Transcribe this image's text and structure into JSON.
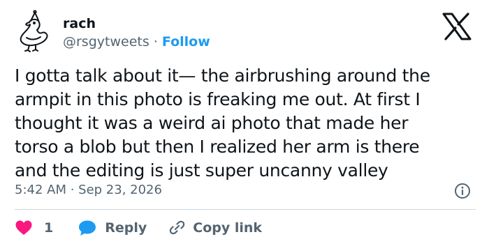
{
  "author": {
    "name": "rach",
    "handle": "@rsgytweets",
    "separator": "·",
    "follow_label": "Follow",
    "avatar_icon": "duck-doodle-avatar"
  },
  "brand": {
    "logo_icon": "x-logo-icon"
  },
  "tweet": {
    "text": "I gotta talk about it— the airbrushing around the\narmpit in this photo is freaking me out. At first I\nthought it was a weird ai photo that made her\ntorso a blob but then I realized her arm is there\nand the editing is just super uncanny valley",
    "timestamp": "5:42 AM · Sep 23, 2026",
    "info_icon": "info-icon"
  },
  "actions": {
    "like_count": "1",
    "reply_label": "Reply",
    "copy_label": "Copy link"
  },
  "colors": {
    "text": "#0f1419",
    "secondary": "#536471",
    "link": "#1d9bf0",
    "like": "#f91880",
    "reply": "#1d9bf0",
    "divider": "#cfd9de"
  }
}
